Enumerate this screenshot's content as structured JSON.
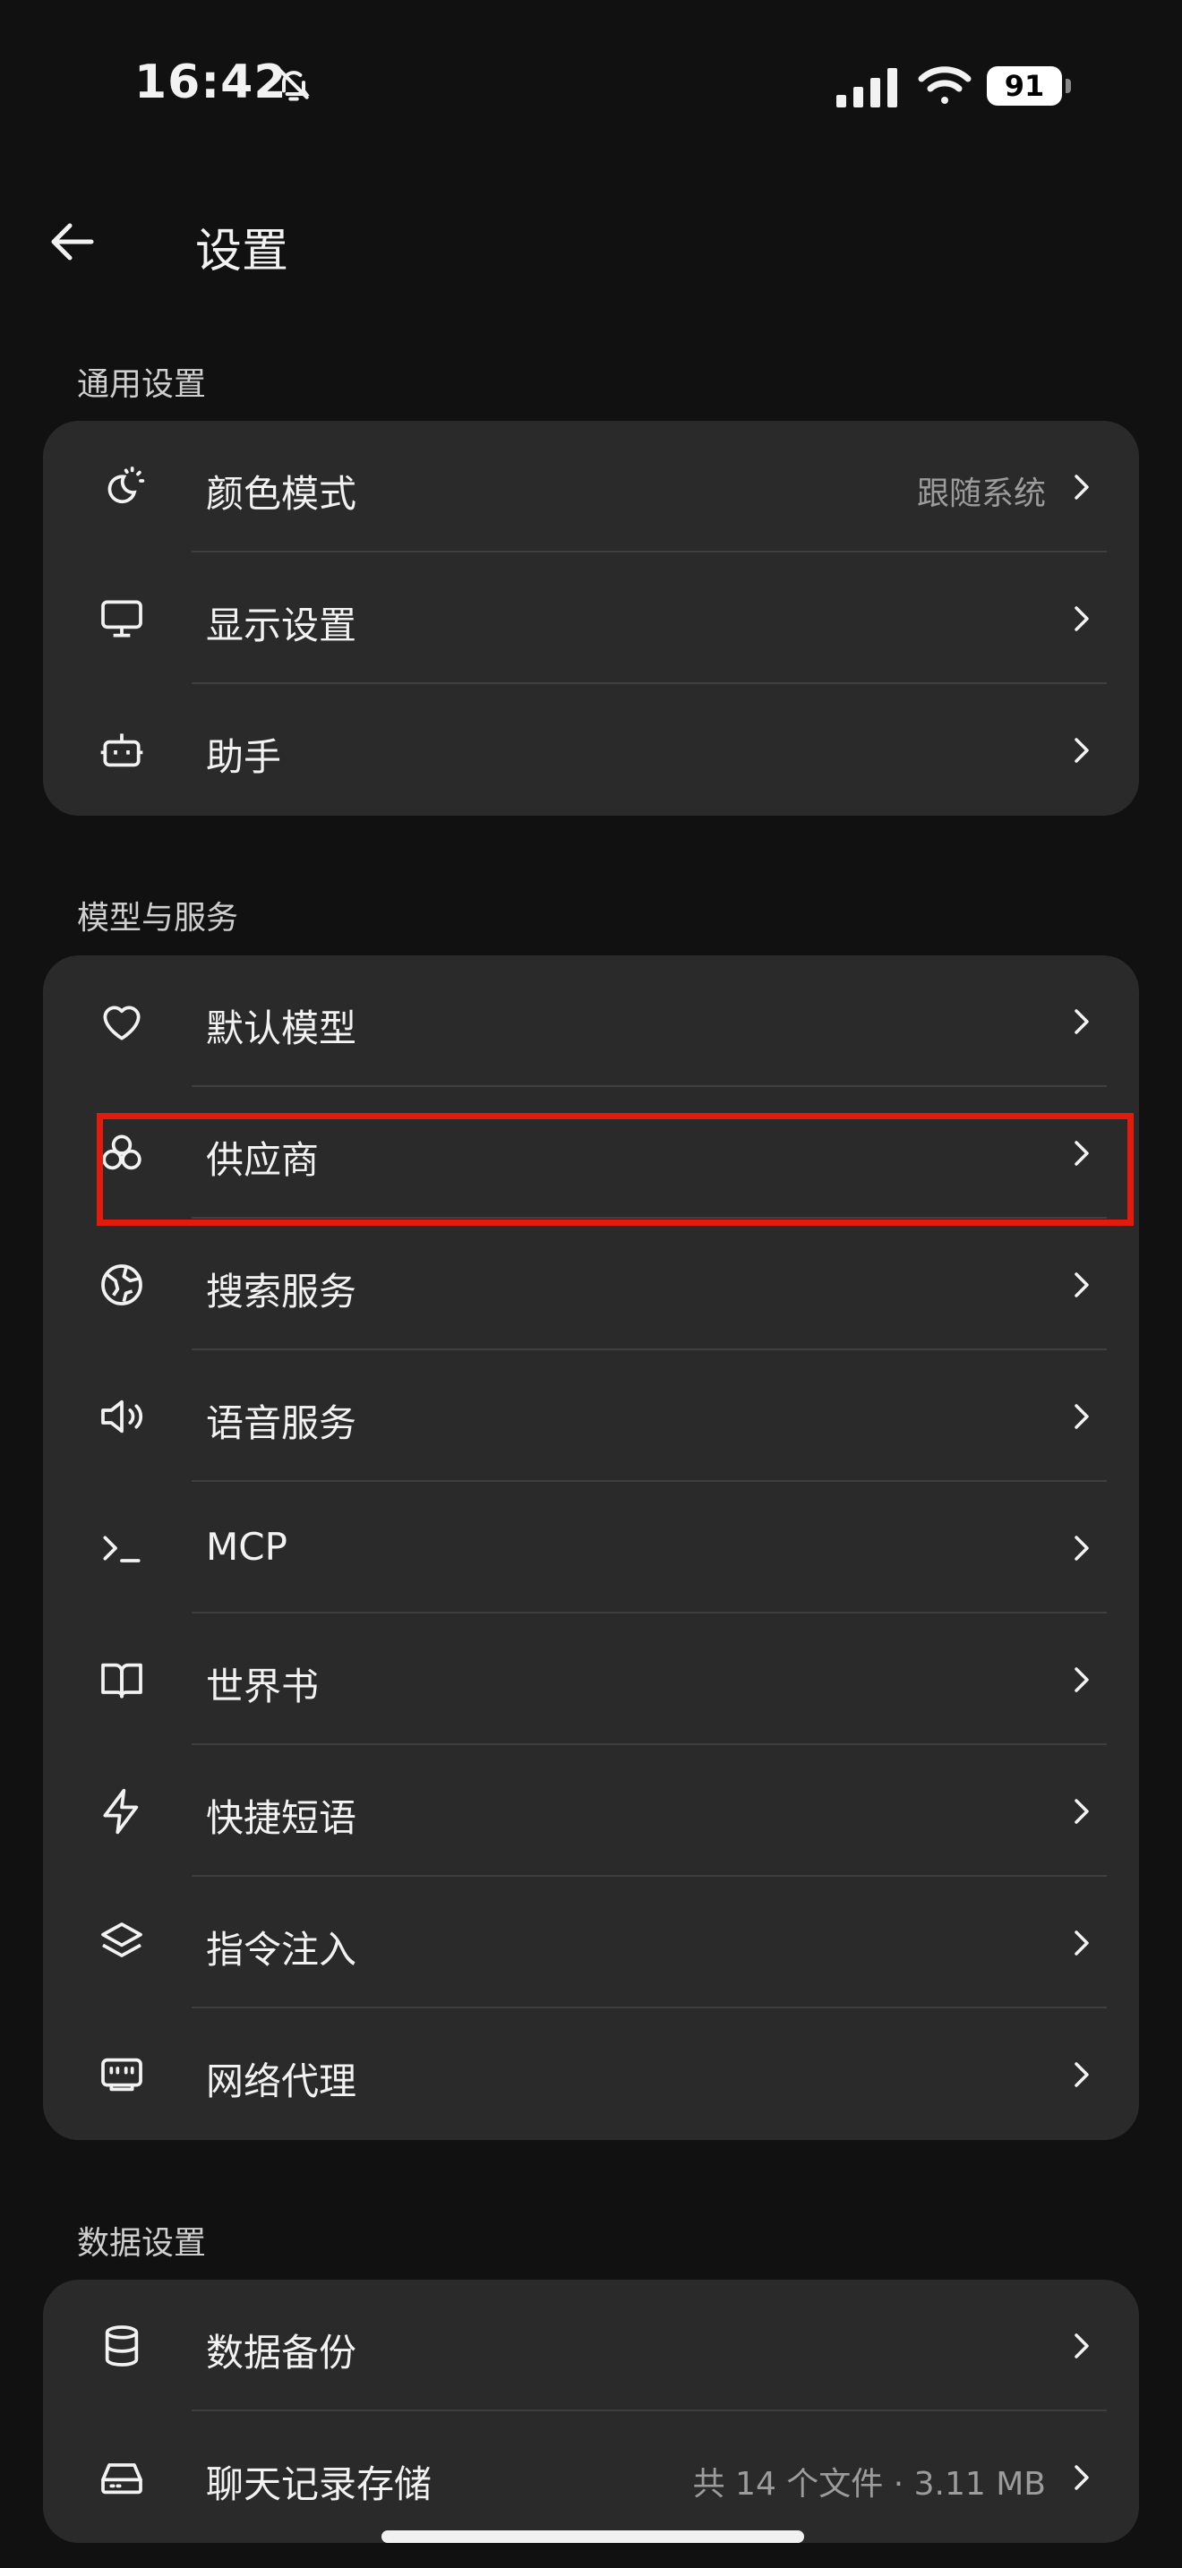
{
  "status_bar": {
    "time": "16:42",
    "battery": "91"
  },
  "header": {
    "title": "设置"
  },
  "sections": [
    {
      "title": "通用设置",
      "items": [
        {
          "label": "颜色模式",
          "value": "跟随系统",
          "icon": "theme-icon"
        },
        {
          "label": "显示设置",
          "value": "",
          "icon": "monitor-icon"
        },
        {
          "label": "助手",
          "value": "",
          "icon": "bot-icon"
        }
      ]
    },
    {
      "title": "模型与服务",
      "items": [
        {
          "label": "默认模型",
          "value": "",
          "icon": "heart-icon"
        },
        {
          "label": "供应商",
          "value": "",
          "icon": "boxes-icon"
        },
        {
          "label": "搜索服务",
          "value": "",
          "icon": "globe-icon"
        },
        {
          "label": "语音服务",
          "value": "",
          "icon": "speaker-icon"
        },
        {
          "label": "MCP",
          "value": "",
          "icon": "terminal-icon"
        },
        {
          "label": "世界书",
          "value": "",
          "icon": "book-icon"
        },
        {
          "label": "快捷短语",
          "value": "",
          "icon": "lightning-icon"
        },
        {
          "label": "指令注入",
          "value": "",
          "icon": "layers-icon"
        },
        {
          "label": "网络代理",
          "value": "",
          "icon": "ethernet-icon"
        }
      ]
    },
    {
      "title": "数据设置",
      "items": [
        {
          "label": "数据备份",
          "value": "",
          "icon": "database-icon"
        },
        {
          "label": "聊天记录存储",
          "value": "共 14 个文件 · 3.11 MB",
          "icon": "drive-icon"
        }
      ]
    }
  ],
  "colors": {
    "background": "#111111",
    "card": "#2a2a2b",
    "highlight": "#e21b0c"
  }
}
